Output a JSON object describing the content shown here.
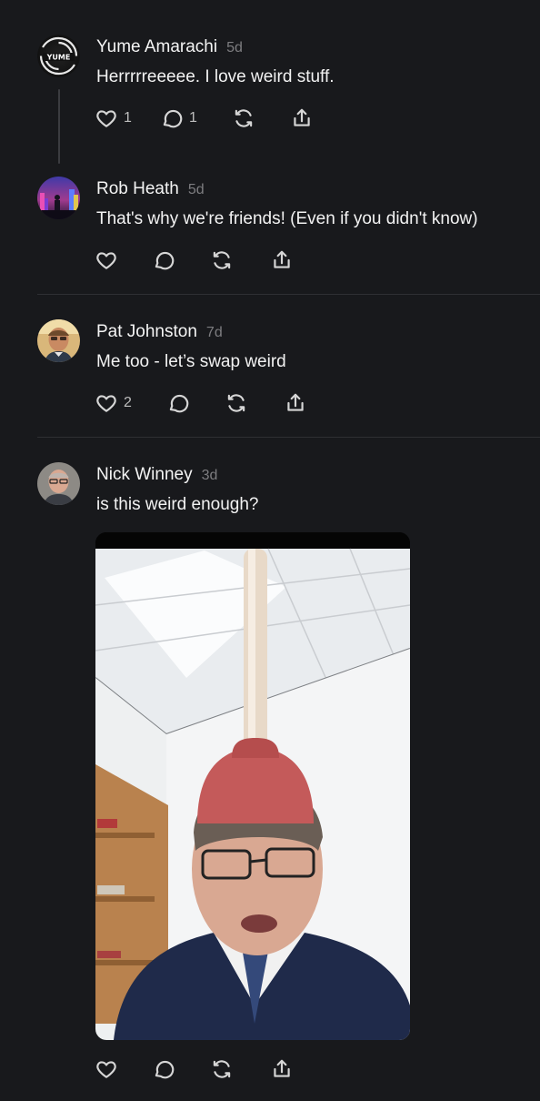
{
  "posts": [
    {
      "author": "Yume Amarachi",
      "time": "5d",
      "text": "Herrrrreeeee. I love weird stuff.",
      "likes": "1",
      "replies": "1",
      "avatar_text": "YUME"
    },
    {
      "author": "Rob Heath",
      "time": "5d",
      "text": "That's why we're friends! (Even if you didn't know)",
      "likes": "",
      "replies": ""
    },
    {
      "author": "Pat Johnston",
      "time": "7d",
      "text": "Me too - let’s swap weird",
      "likes": "2",
      "replies": ""
    },
    {
      "author": "Nick Winney",
      "time": "3d",
      "text": "is this weird enough?",
      "likes": "",
      "replies": ""
    }
  ],
  "icons": {
    "like": "heart-icon",
    "reply": "comment-icon",
    "repost": "repost-icon",
    "share": "share-icon"
  },
  "colors": {
    "background": "#18191c",
    "text": "#f3f3f3",
    "muted": "#7d7d80",
    "divider": "#2e2f33"
  }
}
